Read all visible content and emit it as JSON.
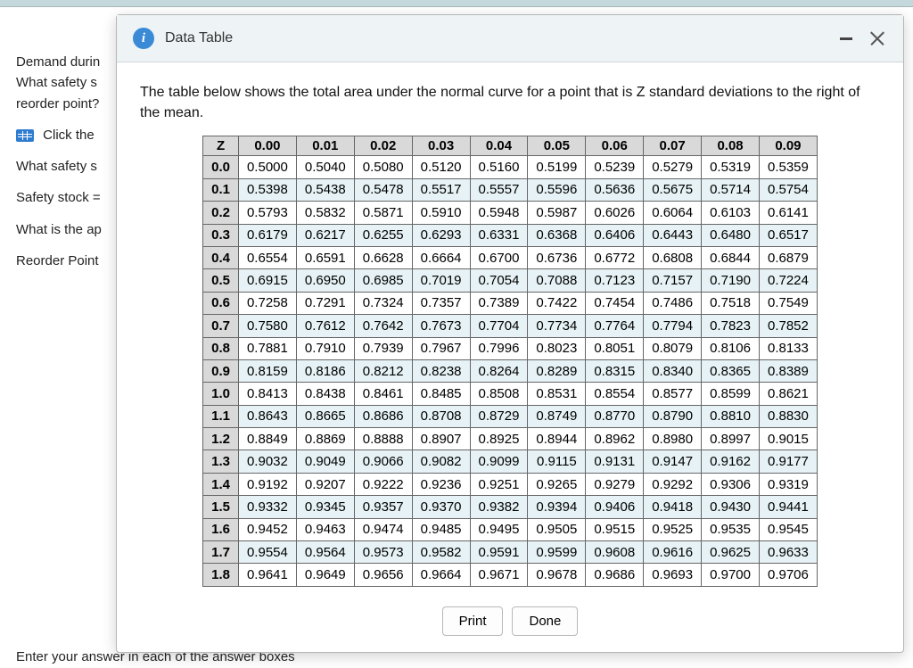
{
  "background": {
    "lines": [
      "Demand durin",
      "What safety s",
      "reorder point?"
    ],
    "click_the": "Click the",
    "what_safety": "What safety s",
    "safety_stock": "Safety stock =",
    "what_is_ap": "What is the ap",
    "reorder_point": "Reorder Point",
    "bottom": "Enter your answer in each of the answer boxes"
  },
  "modal": {
    "title": "Data Table",
    "description": "The table below shows the total area under the normal curve for a point that is Z standard deviations to the right of the mean.",
    "buttons": {
      "print": "Print",
      "done": "Done"
    }
  },
  "chart_data": {
    "type": "table",
    "corner": "Z",
    "col_headers": [
      "0.00",
      "0.01",
      "0.02",
      "0.03",
      "0.04",
      "0.05",
      "0.06",
      "0.07",
      "0.08",
      "0.09"
    ],
    "rows": [
      {
        "z": "0.0",
        "v": [
          "0.5000",
          "0.5040",
          "0.5080",
          "0.5120",
          "0.5160",
          "0.5199",
          "0.5239",
          "0.5279",
          "0.5319",
          "0.5359"
        ]
      },
      {
        "z": "0.1",
        "v": [
          "0.5398",
          "0.5438",
          "0.5478",
          "0.5517",
          "0.5557",
          "0.5596",
          "0.5636",
          "0.5675",
          "0.5714",
          "0.5754"
        ]
      },
      {
        "z": "0.2",
        "v": [
          "0.5793",
          "0.5832",
          "0.5871",
          "0.5910",
          "0.5948",
          "0.5987",
          "0.6026",
          "0.6064",
          "0.6103",
          "0.6141"
        ]
      },
      {
        "z": "0.3",
        "v": [
          "0.6179",
          "0.6217",
          "0.6255",
          "0.6293",
          "0.6331",
          "0.6368",
          "0.6406",
          "0.6443",
          "0.6480",
          "0.6517"
        ]
      },
      {
        "z": "0.4",
        "v": [
          "0.6554",
          "0.6591",
          "0.6628",
          "0.6664",
          "0.6700",
          "0.6736",
          "0.6772",
          "0.6808",
          "0.6844",
          "0.6879"
        ]
      },
      {
        "z": "0.5",
        "v": [
          "0.6915",
          "0.6950",
          "0.6985",
          "0.7019",
          "0.7054",
          "0.7088",
          "0.7123",
          "0.7157",
          "0.7190",
          "0.7224"
        ]
      },
      {
        "z": "0.6",
        "v": [
          "0.7258",
          "0.7291",
          "0.7324",
          "0.7357",
          "0.7389",
          "0.7422",
          "0.7454",
          "0.7486",
          "0.7518",
          "0.7549"
        ]
      },
      {
        "z": "0.7",
        "v": [
          "0.7580",
          "0.7612",
          "0.7642",
          "0.7673",
          "0.7704",
          "0.7734",
          "0.7764",
          "0.7794",
          "0.7823",
          "0.7852"
        ]
      },
      {
        "z": "0.8",
        "v": [
          "0.7881",
          "0.7910",
          "0.7939",
          "0.7967",
          "0.7996",
          "0.8023",
          "0.8051",
          "0.8079",
          "0.8106",
          "0.8133"
        ]
      },
      {
        "z": "0.9",
        "v": [
          "0.8159",
          "0.8186",
          "0.8212",
          "0.8238",
          "0.8264",
          "0.8289",
          "0.8315",
          "0.8340",
          "0.8365",
          "0.8389"
        ]
      },
      {
        "z": "1.0",
        "v": [
          "0.8413",
          "0.8438",
          "0.8461",
          "0.8485",
          "0.8508",
          "0.8531",
          "0.8554",
          "0.8577",
          "0.8599",
          "0.8621"
        ]
      },
      {
        "z": "1.1",
        "v": [
          "0.8643",
          "0.8665",
          "0.8686",
          "0.8708",
          "0.8729",
          "0.8749",
          "0.8770",
          "0.8790",
          "0.8810",
          "0.8830"
        ]
      },
      {
        "z": "1.2",
        "v": [
          "0.8849",
          "0.8869",
          "0.8888",
          "0.8907",
          "0.8925",
          "0.8944",
          "0.8962",
          "0.8980",
          "0.8997",
          "0.9015"
        ]
      },
      {
        "z": "1.3",
        "v": [
          "0.9032",
          "0.9049",
          "0.9066",
          "0.9082",
          "0.9099",
          "0.9115",
          "0.9131",
          "0.9147",
          "0.9162",
          "0.9177"
        ]
      },
      {
        "z": "1.4",
        "v": [
          "0.9192",
          "0.9207",
          "0.9222",
          "0.9236",
          "0.9251",
          "0.9265",
          "0.9279",
          "0.9292",
          "0.9306",
          "0.9319"
        ]
      },
      {
        "z": "1.5",
        "v": [
          "0.9332",
          "0.9345",
          "0.9357",
          "0.9370",
          "0.9382",
          "0.9394",
          "0.9406",
          "0.9418",
          "0.9430",
          "0.9441"
        ]
      },
      {
        "z": "1.6",
        "v": [
          "0.9452",
          "0.9463",
          "0.9474",
          "0.9485",
          "0.9495",
          "0.9505",
          "0.9515",
          "0.9525",
          "0.9535",
          "0.9545"
        ]
      },
      {
        "z": "1.7",
        "v": [
          "0.9554",
          "0.9564",
          "0.9573",
          "0.9582",
          "0.9591",
          "0.9599",
          "0.9608",
          "0.9616",
          "0.9625",
          "0.9633"
        ]
      },
      {
        "z": "1.8",
        "v": [
          "0.9641",
          "0.9649",
          "0.9656",
          "0.9664",
          "0.9671",
          "0.9678",
          "0.9686",
          "0.9693",
          "0.9700",
          "0.9706"
        ]
      }
    ]
  }
}
